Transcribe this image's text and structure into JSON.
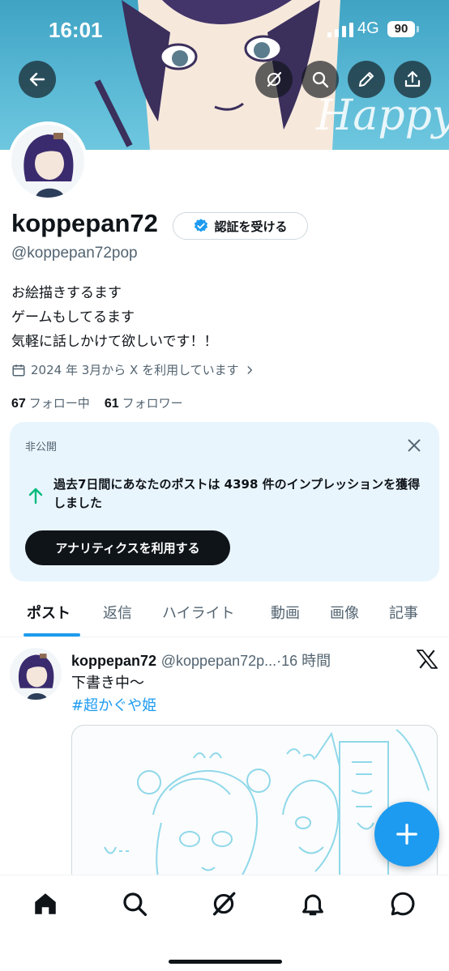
{
  "status": {
    "time": "16:01",
    "network": "4G",
    "battery": "90"
  },
  "header_buttons": {
    "back": "arrow-left-icon",
    "grok": "grok-icon",
    "search": "search-icon",
    "edit": "pencil-icon",
    "share": "share-icon"
  },
  "banner": {
    "text": "Happy"
  },
  "profile": {
    "display_name": "koppepan72",
    "verify_label": "認証を受ける",
    "handle": "@koppepan72pop",
    "bio": [
      "お絵描きするます",
      "ゲームもしてるます",
      "気軽に話しかけて欲しいです！！"
    ],
    "joined": "2024 年 3月から X を利用しています",
    "following_count": "67",
    "following_label": "フォロー中",
    "followers_count": "61",
    "followers_label": "フォロワー"
  },
  "analytics_card": {
    "label": "非公開",
    "message": "過去7日間にあなたのポストは 4398 件のインプレッションを獲得しました",
    "button": "アナリティクスを利用する"
  },
  "tabs": [
    "ポスト",
    "返信",
    "ハイライト",
    "動画",
    "画像",
    "記事"
  ],
  "active_tab": "ポスト",
  "post": {
    "name": "koppepan72",
    "handle": "@koppepan72p...",
    "separator": "·",
    "time": "16 時間",
    "text": "下書き中〜",
    "hashtag": "#超かぐや姫"
  },
  "bottom_nav": [
    "home-icon",
    "search-icon",
    "grok-icon",
    "bell-icon",
    "messages-icon"
  ],
  "colors": {
    "accent": "#1d9bf0",
    "text": "#0f1419",
    "secondary": "#536471",
    "card_bg": "#e9f5fd"
  }
}
